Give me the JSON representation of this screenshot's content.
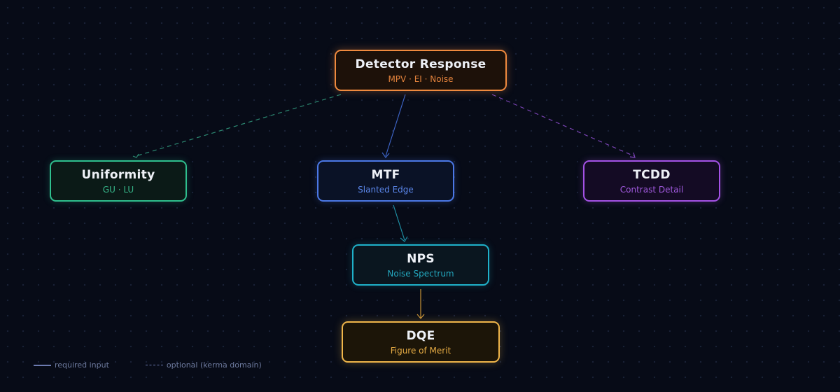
{
  "nodes": {
    "detector": {
      "title": "Detector Response",
      "subtitle": "MPV · EI · Noise",
      "color": "#f08a3e"
    },
    "uniformity": {
      "title": "Uniformity",
      "subtitle": "GU · LU",
      "color": "#2fbf8e"
    },
    "mtf": {
      "title": "MTF",
      "subtitle": "Slanted Edge",
      "color": "#4b78e6"
    },
    "tcdd": {
      "title": "TCDD",
      "subtitle": "Contrast Detail",
      "color": "#a452e6"
    },
    "nps": {
      "title": "NPS",
      "subtitle": "Noise Spectrum",
      "color": "#1fb1c9"
    },
    "dqe": {
      "title": "DQE",
      "subtitle": "Figure of Merit",
      "color": "#f0b64a"
    }
  },
  "edges": [
    {
      "from": "Detector Response",
      "to": "Uniformity",
      "style": "optional"
    },
    {
      "from": "Detector Response",
      "to": "MTF",
      "style": "required"
    },
    {
      "from": "Detector Response",
      "to": "TCDD",
      "style": "optional"
    },
    {
      "from": "MTF",
      "to": "NPS",
      "style": "required"
    },
    {
      "from": "NPS",
      "to": "DQE",
      "style": "required"
    }
  ],
  "legend": {
    "required": "required input",
    "optional": "optional (kerma domain)"
  }
}
